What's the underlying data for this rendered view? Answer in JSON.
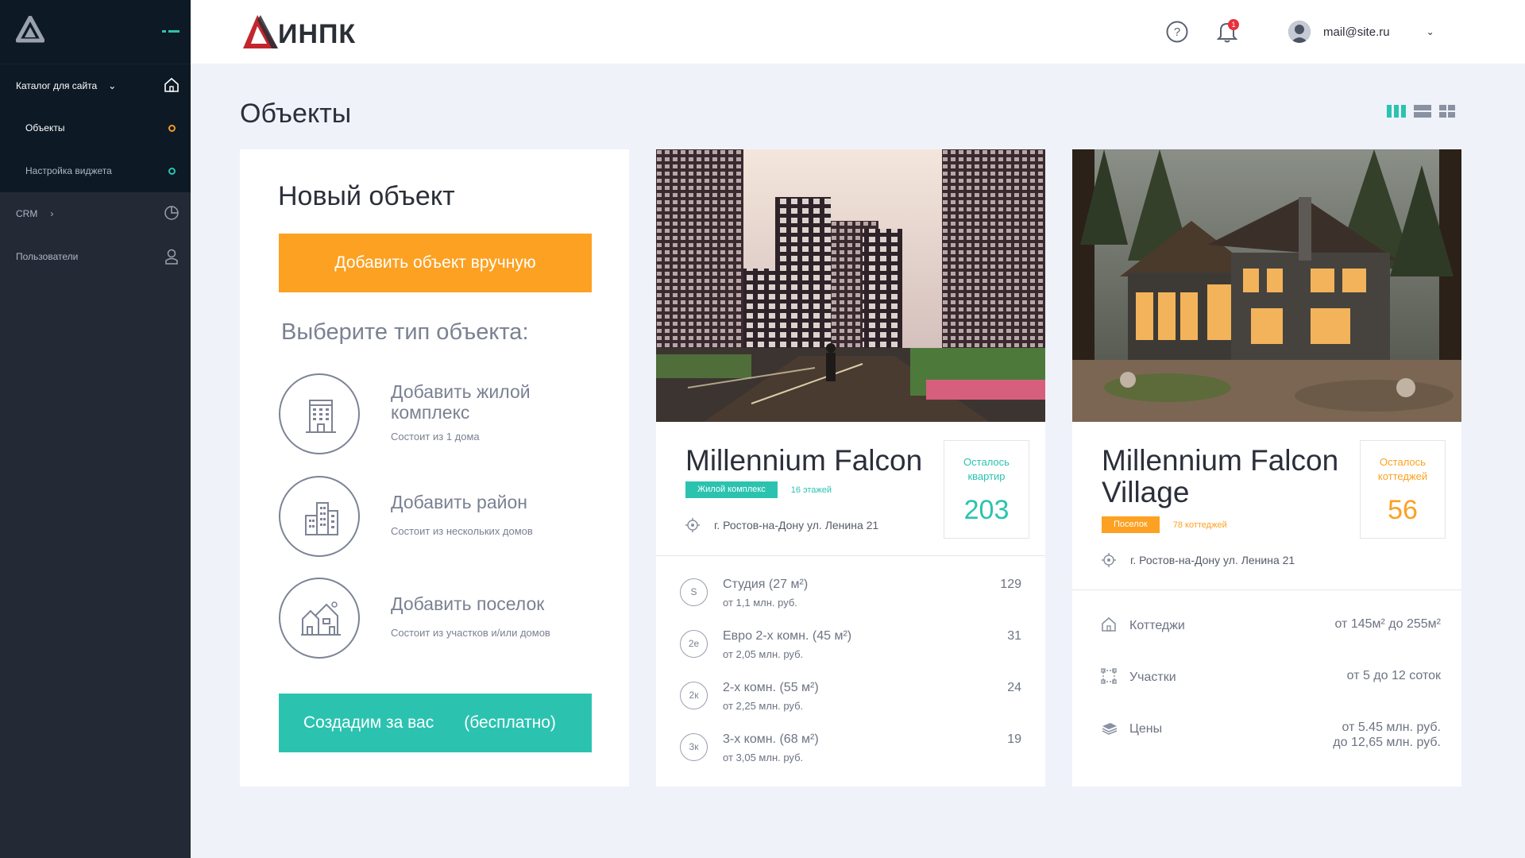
{
  "sidebar": {
    "section": {
      "label": "Каталог для сайта"
    },
    "subitems": [
      {
        "label": "Объекты"
      },
      {
        "label": "Настройка виджета"
      }
    ],
    "items": [
      {
        "label": "CRM"
      },
      {
        "label": "Пользователи"
      }
    ]
  },
  "topbar": {
    "brand": "ИНПК",
    "notifications_count": "1",
    "user_email": "mail@site.ru"
  },
  "page": {
    "title": "Объекты"
  },
  "new_object": {
    "title": "Новый объект",
    "add_manual_label": "Добавить объект вручную",
    "choose_type_label": "Выберите тип объекта:",
    "options": [
      {
        "title": "Добавить жилой комплекс",
        "desc": "Состоит из 1 дома"
      },
      {
        "title": "Добавить район",
        "desc": "Состоит из нескольких домов"
      },
      {
        "title": "Добавить поселок",
        "desc": "Состоит из участков и/или домов"
      }
    ],
    "create_for_you_label": "Создадим за вас",
    "create_for_you_free": "(бесплатно)"
  },
  "objects": [
    {
      "name": "Millennium Falcon",
      "tag": "Жилой комплекс",
      "tag_note": "16 этажей",
      "address": "г. Ростов-на-Дону ул. Ленина 21",
      "left_label_1": "Осталось",
      "left_label_2": "квартир",
      "left_count": "203",
      "flats": [
        {
          "code": "S",
          "name": "Студия (27 м²)",
          "price": "от 1,1 млн. руб.",
          "count": "129"
        },
        {
          "code": "2е",
          "name": "Евро 2-х комн. (45 м²)",
          "price": "от 2,05 млн. руб.",
          "count": "31"
        },
        {
          "code": "2к",
          "name": "2-х комн. (55 м²)",
          "price": "от 2,25 млн. руб.",
          "count": "24"
        },
        {
          "code": "3к",
          "name": "3-х комн. (68 м²)",
          "price": "от 3,05 млн. руб.",
          "count": "19"
        }
      ]
    },
    {
      "name": "Millennium Falcon Village",
      "tag": "Поселок",
      "tag_note": "78 коттеджей",
      "address": "г. Ростов-на-Дону ул. Ленина 21",
      "left_label_1": "Осталось",
      "left_label_2": "коттеджей",
      "left_count": "56",
      "rows": [
        {
          "label": "Коттеджи",
          "value": "от  145м²  до  255м²"
        },
        {
          "label": "Участки",
          "value": "от  5  до  12  соток"
        },
        {
          "label": "Цены",
          "value_1": "от  5.45  млн. руб.",
          "value_2": "до  12,65  млн. руб."
        }
      ]
    }
  ],
  "colors": {
    "orange": "#fca122",
    "teal": "#2bc3b0",
    "sidebar": "#232a36",
    "sidebar_dark": "#0d1a26",
    "background": "#eff2f9"
  }
}
